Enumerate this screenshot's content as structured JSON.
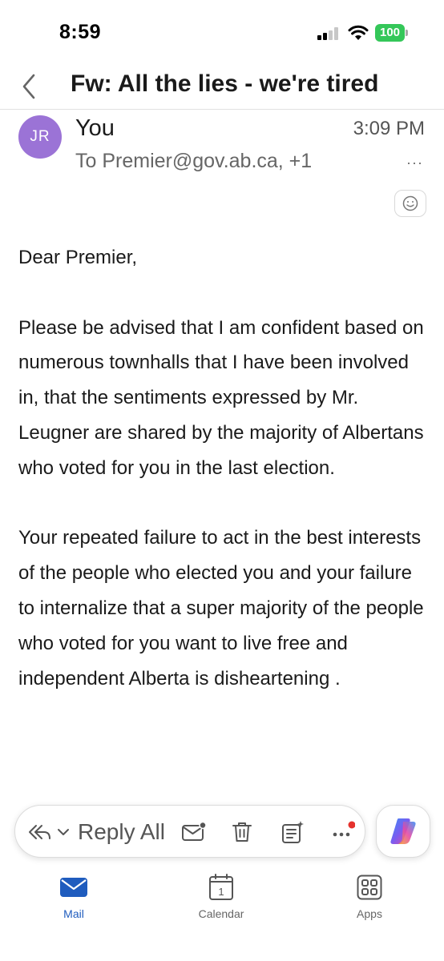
{
  "status_bar": {
    "time": "8:59",
    "battery": "100"
  },
  "header": {
    "subject": "Fw: All the lies - we're tired"
  },
  "sender": {
    "initials": "JR",
    "name": "You",
    "time": "3:09 PM",
    "recipients": "To Premier@gov.ab.ca, +1",
    "more": "···"
  },
  "body": {
    "paragraphs": [
      "Dear Premier,",
      "Please be advised that I am confident based on numerous townhalls that I have been involved in, that the sentiments expressed by Mr. Leugner are shared by the majority of Albertans who voted for you in the last election.",
      "Your repeated failure to act in the best interests of the people who elected you and your failure to internalize that a super majority of the people who voted for you want to live free and independent Alberta is disheartening ."
    ]
  },
  "action_bar": {
    "reply_label": "Reply All",
    "icons": [
      "reply-all-icon",
      "chevron-down-icon",
      "mark-unread-icon",
      "trash-icon",
      "summarize-icon",
      "more-icon",
      "copilot-icon"
    ],
    "notification_color": "#e5322d"
  },
  "tabs": [
    {
      "label": "Mail",
      "icon": "mail-icon",
      "active": true
    },
    {
      "label": "Calendar",
      "icon": "calendar-icon",
      "day": "1",
      "active": false
    },
    {
      "label": "Apps",
      "icon": "apps-icon",
      "active": false
    }
  ],
  "colors": {
    "accent": "#1f5cbe",
    "avatar": "#9b73d6",
    "battery": "#34c759"
  }
}
